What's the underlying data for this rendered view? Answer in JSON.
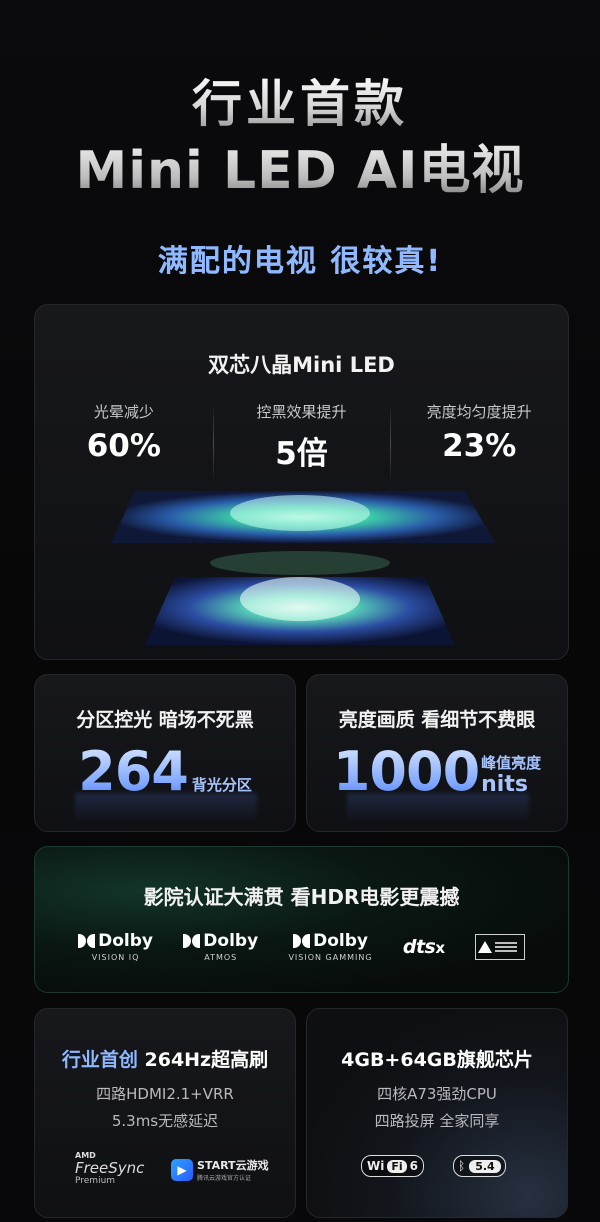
{
  "hero": {
    "line1": "行业首款",
    "line2": "Mini LED AI电视"
  },
  "tagline": "满配的电视 很较真!",
  "chip_card": {
    "title": "双芯八晶Mini LED",
    "stats": [
      {
        "label": "光晕减少",
        "value": "60%"
      },
      {
        "label": "控黑效果提升",
        "value": "5倍"
      },
      {
        "label": "亮度均匀度提升",
        "value": "23%"
      }
    ]
  },
  "zones_card": {
    "title": "分区控光 暗场不死黑",
    "number": "264",
    "unit": "背光分区"
  },
  "brightness_card": {
    "title": "亮度画质 看细节不费眼",
    "number": "1000",
    "unit_top": "峰值亮度",
    "unit_bottom": "nits"
  },
  "cinema_card": {
    "title": "影院认证大满贯  看HDR电影更震撼",
    "logos": [
      {
        "brand": "Dolby",
        "sub": "VISION IQ"
      },
      {
        "brand": "Dolby",
        "sub": "ATMOS"
      },
      {
        "brand": "Dolby",
        "sub": "VISION GAMMING"
      }
    ],
    "dts": "dts",
    "dts_x": "x"
  },
  "refresh_card": {
    "title_highlight": "行业首创",
    "title_rest": "264Hz超高刷",
    "line1": "四路HDMI2.1+VRR",
    "line2": "5.3ms无感延迟",
    "amd_top": "AMD",
    "amd_mid": "FreeSync",
    "amd_bottom": "Premium",
    "start_name": "START云游戏",
    "start_sub": "腾讯云游戏官方认证"
  },
  "chip_spec_card": {
    "title": "4GB+64GB旗舰芯片",
    "line1": "四核A73强劲CPU",
    "line2": "四路投屏 全家同享",
    "wifi_a": "Wi",
    "wifi_b": "Fi",
    "wifi_c": "6",
    "bt_icon": "ᛒ",
    "bt_ver": "5.4"
  },
  "colors": {
    "accent": "#8fb9ff",
    "card_bg": "#141519",
    "bg": "#070709"
  }
}
